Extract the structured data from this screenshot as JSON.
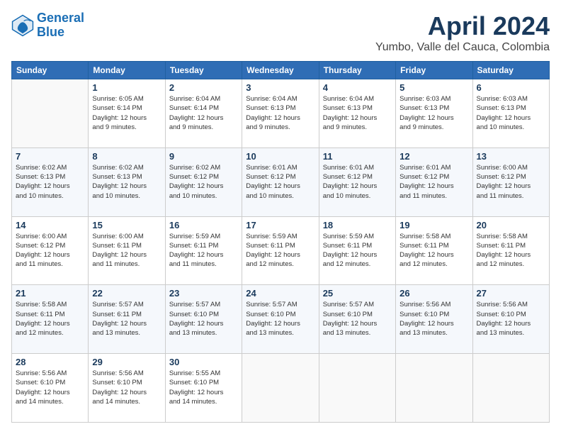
{
  "header": {
    "logo_line1": "General",
    "logo_line2": "Blue",
    "title": "April 2024",
    "subtitle": "Yumbo, Valle del Cauca, Colombia"
  },
  "weekdays": [
    "Sunday",
    "Monday",
    "Tuesday",
    "Wednesday",
    "Thursday",
    "Friday",
    "Saturday"
  ],
  "weeks": [
    [
      {
        "day": "",
        "info": ""
      },
      {
        "day": "1",
        "info": "Sunrise: 6:05 AM\nSunset: 6:14 PM\nDaylight: 12 hours\nand 9 minutes."
      },
      {
        "day": "2",
        "info": "Sunrise: 6:04 AM\nSunset: 6:14 PM\nDaylight: 12 hours\nand 9 minutes."
      },
      {
        "day": "3",
        "info": "Sunrise: 6:04 AM\nSunset: 6:13 PM\nDaylight: 12 hours\nand 9 minutes."
      },
      {
        "day": "4",
        "info": "Sunrise: 6:04 AM\nSunset: 6:13 PM\nDaylight: 12 hours\nand 9 minutes."
      },
      {
        "day": "5",
        "info": "Sunrise: 6:03 AM\nSunset: 6:13 PM\nDaylight: 12 hours\nand 9 minutes."
      },
      {
        "day": "6",
        "info": "Sunrise: 6:03 AM\nSunset: 6:13 PM\nDaylight: 12 hours\nand 10 minutes."
      }
    ],
    [
      {
        "day": "7",
        "info": "Sunrise: 6:02 AM\nSunset: 6:13 PM\nDaylight: 12 hours\nand 10 minutes."
      },
      {
        "day": "8",
        "info": "Sunrise: 6:02 AM\nSunset: 6:13 PM\nDaylight: 12 hours\nand 10 minutes."
      },
      {
        "day": "9",
        "info": "Sunrise: 6:02 AM\nSunset: 6:12 PM\nDaylight: 12 hours\nand 10 minutes."
      },
      {
        "day": "10",
        "info": "Sunrise: 6:01 AM\nSunset: 6:12 PM\nDaylight: 12 hours\nand 10 minutes."
      },
      {
        "day": "11",
        "info": "Sunrise: 6:01 AM\nSunset: 6:12 PM\nDaylight: 12 hours\nand 10 minutes."
      },
      {
        "day": "12",
        "info": "Sunrise: 6:01 AM\nSunset: 6:12 PM\nDaylight: 12 hours\nand 11 minutes."
      },
      {
        "day": "13",
        "info": "Sunrise: 6:00 AM\nSunset: 6:12 PM\nDaylight: 12 hours\nand 11 minutes."
      }
    ],
    [
      {
        "day": "14",
        "info": "Sunrise: 6:00 AM\nSunset: 6:12 PM\nDaylight: 12 hours\nand 11 minutes."
      },
      {
        "day": "15",
        "info": "Sunrise: 6:00 AM\nSunset: 6:11 PM\nDaylight: 12 hours\nand 11 minutes."
      },
      {
        "day": "16",
        "info": "Sunrise: 5:59 AM\nSunset: 6:11 PM\nDaylight: 12 hours\nand 11 minutes."
      },
      {
        "day": "17",
        "info": "Sunrise: 5:59 AM\nSunset: 6:11 PM\nDaylight: 12 hours\nand 12 minutes."
      },
      {
        "day": "18",
        "info": "Sunrise: 5:59 AM\nSunset: 6:11 PM\nDaylight: 12 hours\nand 12 minutes."
      },
      {
        "day": "19",
        "info": "Sunrise: 5:58 AM\nSunset: 6:11 PM\nDaylight: 12 hours\nand 12 minutes."
      },
      {
        "day": "20",
        "info": "Sunrise: 5:58 AM\nSunset: 6:11 PM\nDaylight: 12 hours\nand 12 minutes."
      }
    ],
    [
      {
        "day": "21",
        "info": "Sunrise: 5:58 AM\nSunset: 6:11 PM\nDaylight: 12 hours\nand 12 minutes."
      },
      {
        "day": "22",
        "info": "Sunrise: 5:57 AM\nSunset: 6:11 PM\nDaylight: 12 hours\nand 13 minutes."
      },
      {
        "day": "23",
        "info": "Sunrise: 5:57 AM\nSunset: 6:10 PM\nDaylight: 12 hours\nand 13 minutes."
      },
      {
        "day": "24",
        "info": "Sunrise: 5:57 AM\nSunset: 6:10 PM\nDaylight: 12 hours\nand 13 minutes."
      },
      {
        "day": "25",
        "info": "Sunrise: 5:57 AM\nSunset: 6:10 PM\nDaylight: 12 hours\nand 13 minutes."
      },
      {
        "day": "26",
        "info": "Sunrise: 5:56 AM\nSunset: 6:10 PM\nDaylight: 12 hours\nand 13 minutes."
      },
      {
        "day": "27",
        "info": "Sunrise: 5:56 AM\nSunset: 6:10 PM\nDaylight: 12 hours\nand 13 minutes."
      }
    ],
    [
      {
        "day": "28",
        "info": "Sunrise: 5:56 AM\nSunset: 6:10 PM\nDaylight: 12 hours\nand 14 minutes."
      },
      {
        "day": "29",
        "info": "Sunrise: 5:56 AM\nSunset: 6:10 PM\nDaylight: 12 hours\nand 14 minutes."
      },
      {
        "day": "30",
        "info": "Sunrise: 5:55 AM\nSunset: 6:10 PM\nDaylight: 12 hours\nand 14 minutes."
      },
      {
        "day": "",
        "info": ""
      },
      {
        "day": "",
        "info": ""
      },
      {
        "day": "",
        "info": ""
      },
      {
        "day": "",
        "info": ""
      }
    ]
  ]
}
